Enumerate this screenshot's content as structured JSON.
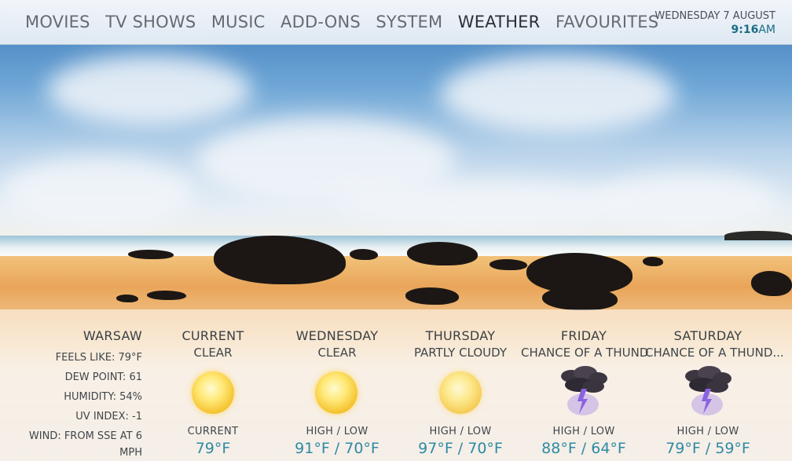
{
  "nav": {
    "items": [
      "MOVIES",
      "TV SHOWS",
      "MUSIC",
      "ADD-ONS",
      "SYSTEM",
      "WEATHER",
      "FAVOURITES"
    ],
    "active": "WEATHER"
  },
  "clock": {
    "date": "WEDNESDAY 7 AUGUST",
    "time": "9:16",
    "ampm": "AM"
  },
  "location": {
    "name": "WARSAW",
    "feels_like": "FEELS LIKE: 79°F",
    "dew_point": "DEW POINT: 61",
    "humidity": "HUMIDITY: 54%",
    "uv_index": "UV INDEX: -1",
    "wind_line1": "WIND: FROM SSE AT 6",
    "wind_line2": "MPH"
  },
  "forecast": [
    {
      "day": "CURRENT",
      "condition": "CLEAR",
      "icon": "sun-icon",
      "label": "CURRENT",
      "temp": "79°F"
    },
    {
      "day": "WEDNESDAY",
      "condition": "CLEAR",
      "icon": "sun-icon",
      "label": "HIGH / LOW",
      "temp": "91°F / 70°F"
    },
    {
      "day": "THURSDAY",
      "condition": "PARTLY CLOUDY",
      "icon": "sun-icon",
      "label": "HIGH / LOW",
      "temp": "97°F / 70°F"
    },
    {
      "day": "FRIDAY",
      "condition": "CHANCE OF A THUND",
      "icon": "thunderstorm-icon",
      "label": "HIGH / LOW",
      "temp": "88°F / 64°F"
    },
    {
      "day": "SATURDAY",
      "condition": "CHANCE OF A THUND...",
      "icon": "thunderstorm-icon",
      "label": "HIGH / LOW",
      "temp": "79°F / 59°F"
    }
  ],
  "colors": {
    "accent": "#2d8ba3",
    "time": "#1c6c86",
    "text": "#3a3f44"
  }
}
